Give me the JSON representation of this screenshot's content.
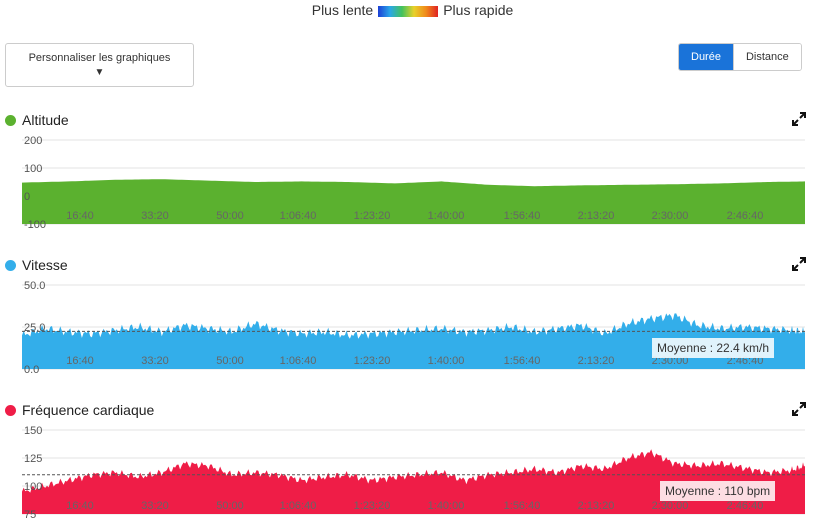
{
  "legend": {
    "slow": "Plus lente",
    "fast": "Plus rapide"
  },
  "customize_button": {
    "label": "Personnaliser les graphiques"
  },
  "view_toggle": {
    "duration": "Durée",
    "distance": "Distance"
  },
  "colors": {
    "altitude": "#5bb12f",
    "speed": "#33aeea",
    "heart_rate": "#ef1d47",
    "toggle_active": "#1a73d9"
  },
  "icons": {
    "expand": "expand-arrows-icon",
    "dropdown": "triangle-down-icon"
  },
  "x_ticks": [
    "16:40",
    "33:20",
    "50:00",
    "1:06:40",
    "1:23:20",
    "1:40:00",
    "1:56:40",
    "2:13:20",
    "2:30:00",
    "2:46:40"
  ],
  "chart_data": [
    {
      "type": "area",
      "title": "Altitude",
      "y_ticks": [
        "200",
        "100",
        "0",
        "-100"
      ],
      "ylim": [
        -100,
        200
      ],
      "xlim_seconds": [
        0,
        10080
      ],
      "x": [
        0,
        600,
        1200,
        1800,
        2400,
        3000,
        3600,
        4200,
        4800,
        5400,
        6000,
        6600,
        7200,
        7800,
        8400,
        9000,
        9600,
        10080
      ],
      "values": [
        48,
        52,
        58,
        60,
        55,
        50,
        52,
        50,
        45,
        52,
        40,
        35,
        38,
        40,
        42,
        45,
        50,
        52
      ]
    },
    {
      "type": "area",
      "title": "Vitesse",
      "y_ticks": [
        "50.0",
        "25.0",
        "0.0"
      ],
      "ylim": [
        0,
        50
      ],
      "xlim_seconds": [
        0,
        10080
      ],
      "average_label": "Moyenne : 22.4 km/h",
      "average": 22.4,
      "x": [
        0,
        300,
        600,
        900,
        1200,
        1500,
        1800,
        2100,
        2400,
        2700,
        3000,
        3300,
        3600,
        3900,
        4200,
        4500,
        4800,
        5100,
        5400,
        5700,
        6000,
        6300,
        6600,
        6900,
        7200,
        7500,
        7800,
        8100,
        8400,
        8700,
        9000,
        9300,
        9600,
        9900,
        10080
      ],
      "values": [
        20,
        24,
        22,
        21,
        23,
        25,
        22,
        26,
        24,
        22,
        27,
        23,
        21,
        22,
        20,
        21,
        22,
        23,
        24,
        22,
        23,
        25,
        22,
        24,
        26,
        21,
        27,
        30,
        32,
        26,
        24,
        25,
        24,
        23,
        22
      ]
    },
    {
      "type": "area",
      "title": "Fréquence cardiaque",
      "y_ticks": [
        "150",
        "125",
        "100",
        "75"
      ],
      "ylim": [
        75,
        150
      ],
      "xlim_seconds": [
        0,
        10080
      ],
      "average_label": "Moyenne : 110 bpm",
      "average": 110,
      "x": [
        0,
        300,
        600,
        900,
        1200,
        1500,
        1800,
        2100,
        2400,
        2700,
        3000,
        3300,
        3600,
        3900,
        4200,
        4500,
        4800,
        5100,
        5400,
        5700,
        6000,
        6300,
        6600,
        6900,
        7200,
        7500,
        7800,
        8100,
        8400,
        8700,
        9000,
        9300,
        9600,
        9900,
        10080
      ],
      "values": [
        95,
        100,
        105,
        110,
        112,
        108,
        112,
        120,
        118,
        110,
        112,
        110,
        105,
        108,
        110,
        105,
        108,
        110,
        112,
        105,
        110,
        112,
        115,
        112,
        118,
        115,
        125,
        130,
        120,
        118,
        120,
        116,
        112,
        114,
        118
      ]
    }
  ]
}
